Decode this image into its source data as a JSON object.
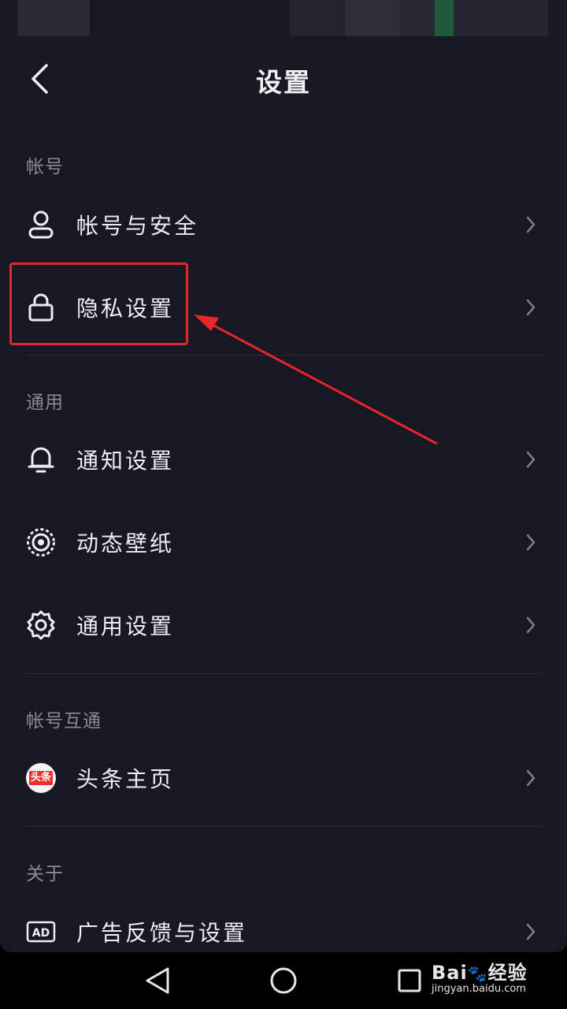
{
  "header": {
    "title": "设置"
  },
  "sections": {
    "account": "帐号",
    "general": "通用",
    "linked": "帐号互通",
    "about": "关于"
  },
  "items": {
    "account_security": "帐号与安全",
    "privacy": "隐私设置",
    "notifications": "通知设置",
    "wallpaper": "动态壁纸",
    "general_settings": "通用设置",
    "toutiao": "头条主页",
    "ad_feedback": "广告反馈与设置"
  },
  "icons": {
    "toutiao_badge": "头条",
    "ad_badge": "AD"
  },
  "watermark": {
    "brand": "Bai",
    "brand_cn": "经验",
    "url": "jingyan.baidu.com"
  },
  "colors": {
    "background": "#161823",
    "highlight": "#e8252b",
    "text": "#eceef3",
    "muted": "#8a8b93"
  }
}
